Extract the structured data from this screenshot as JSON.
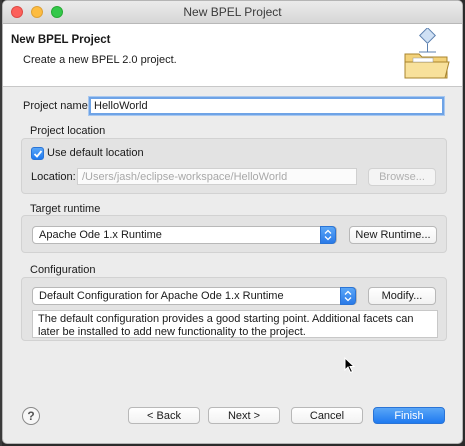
{
  "window": {
    "title": "New BPEL Project"
  },
  "banner": {
    "title": "New BPEL Project",
    "description": "Create a new BPEL 2.0 project.",
    "icon": "new-project-folder-icon"
  },
  "project_name": {
    "label": "Project name:",
    "value": "HelloWorld"
  },
  "project_location": {
    "group_label": "Project location",
    "use_default_label": "Use default location",
    "use_default_checked": true,
    "location_label": "Location:",
    "location_value": "/Users/jash/eclipse-workspace/HelloWorld",
    "browse_label": "Browse..."
  },
  "target_runtime": {
    "group_label": "Target runtime",
    "selected": "Apache Ode 1.x Runtime",
    "new_runtime_label": "New Runtime..."
  },
  "configuration": {
    "group_label": "Configuration",
    "selected": "Default Configuration for Apache Ode 1.x Runtime",
    "modify_label": "Modify...",
    "description": "The default configuration provides a good starting point. Additional facets can later be installed to add new functionality to the project."
  },
  "footer": {
    "help_icon": "?",
    "back_label": "< Back",
    "next_label": "Next >",
    "cancel_label": "Cancel",
    "finish_label": "Finish"
  },
  "colors": {
    "accent": "#1f7af0",
    "window_bg": "#ececec"
  }
}
